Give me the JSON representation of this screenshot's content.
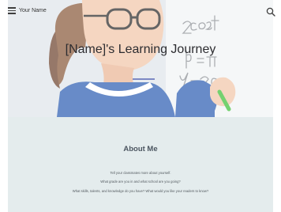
{
  "header": {
    "site_title": "Your Name"
  },
  "hero": {
    "title": "[Name]'s Learning Journey",
    "board_equations": [
      "x = 2cos2t",
      "p = π",
      "y = 2cos"
    ]
  },
  "about": {
    "heading": "About Me",
    "lines": [
      "Tell your classmates more about yourself.",
      "What grade are you in and what school are you going?",
      "What skills, talents, and knowledge do you have? What would you like your readers to know?"
    ]
  },
  "colors": {
    "accent": "#7d89c4",
    "about_bg": "#e4eced",
    "heading_text": "#4b5560"
  },
  "icons": {
    "menu": "menu-icon",
    "search": "search-icon"
  }
}
